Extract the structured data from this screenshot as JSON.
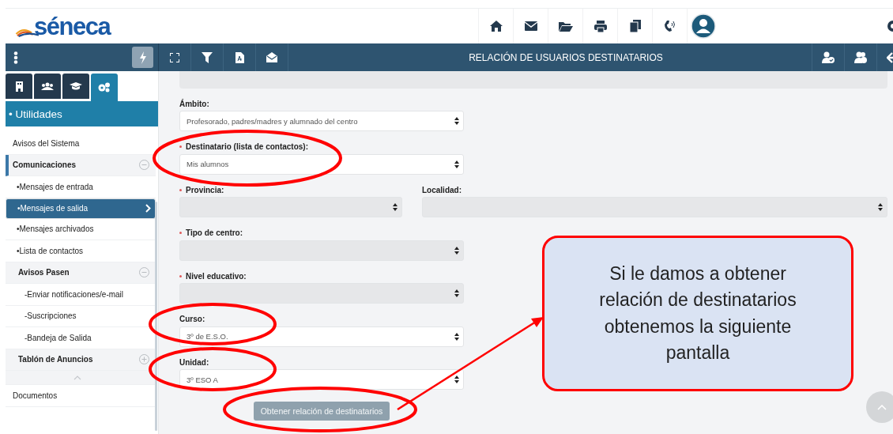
{
  "header": {
    "logo": "séneca"
  },
  "toolbar": {
    "title": "RELACIÓN DE USUARIOS DESTINATARIOS"
  },
  "sidebar": {
    "tabs": [
      {
        "selected": false
      },
      {
        "selected": false
      },
      {
        "selected": false
      },
      {
        "selected": true
      }
    ],
    "section": "• Utilidades",
    "items": [
      {
        "label": "Avisos del Sistema",
        "kind": "link",
        "selected": false
      },
      {
        "label": "Comunicaciones",
        "kind": "group",
        "expanded": true,
        "selected": false,
        "children": [
          {
            "label": "•Mensajes de entrada",
            "kind": "link",
            "selected": false
          },
          {
            "label": "•Mensajes de salida",
            "kind": "link",
            "selected": true
          },
          {
            "label": "•Mensajes archivados",
            "kind": "link",
            "selected": false
          },
          {
            "label": "•Lista de contactos",
            "kind": "link",
            "selected": false
          },
          {
            "label": "Avisos Pasen",
            "kind": "group",
            "expanded": true,
            "selected": false,
            "children": [
              {
                "label": "-Enviar notificaciones/e-mail",
                "kind": "link",
                "selected": false
              },
              {
                "label": "-Suscripciones",
                "kind": "link",
                "selected": false
              },
              {
                "label": "-Bandeja de Salida",
                "kind": "link",
                "selected": false
              }
            ]
          },
          {
            "label": "Tablón de Anuncios",
            "kind": "group",
            "expanded": false,
            "selected": false
          }
        ]
      },
      {
        "kind": "collapse"
      },
      {
        "label": "Documentos",
        "kind": "link",
        "selected": false
      }
    ]
  },
  "form": {
    "rows": [
      [
        {
          "label": "Ámbito:",
          "required": false,
          "disabled": false,
          "value": "Profesorado, padres/madres y alumnado del centro"
        }
      ],
      [
        {
          "label": "Destinatario (lista de contactos):",
          "required": true,
          "disabled": false,
          "value": "Mis alumnos"
        }
      ],
      [
        {
          "label": "Provincia:",
          "required": true,
          "disabled": true
        },
        {
          "label": "Localidad:",
          "required": false,
          "disabled": true
        }
      ],
      [
        {
          "label": "Tipo de centro:",
          "required": true,
          "disabled": true
        }
      ],
      [
        {
          "label": "Nivel educativo:",
          "required": true,
          "disabled": true
        }
      ],
      [
        {
          "label": "Curso:",
          "required": false,
          "disabled": false,
          "value": "3º de E.S.O."
        }
      ],
      [
        {
          "label": "Unidad:",
          "required": false,
          "disabled": false,
          "value": "3º ESO A"
        }
      ]
    ],
    "button": "Obtener relación de destinatarios"
  },
  "callout": {
    "text": "Si le damos a obtener relación de destinatarios obtenemos la siguiente pantalla"
  }
}
